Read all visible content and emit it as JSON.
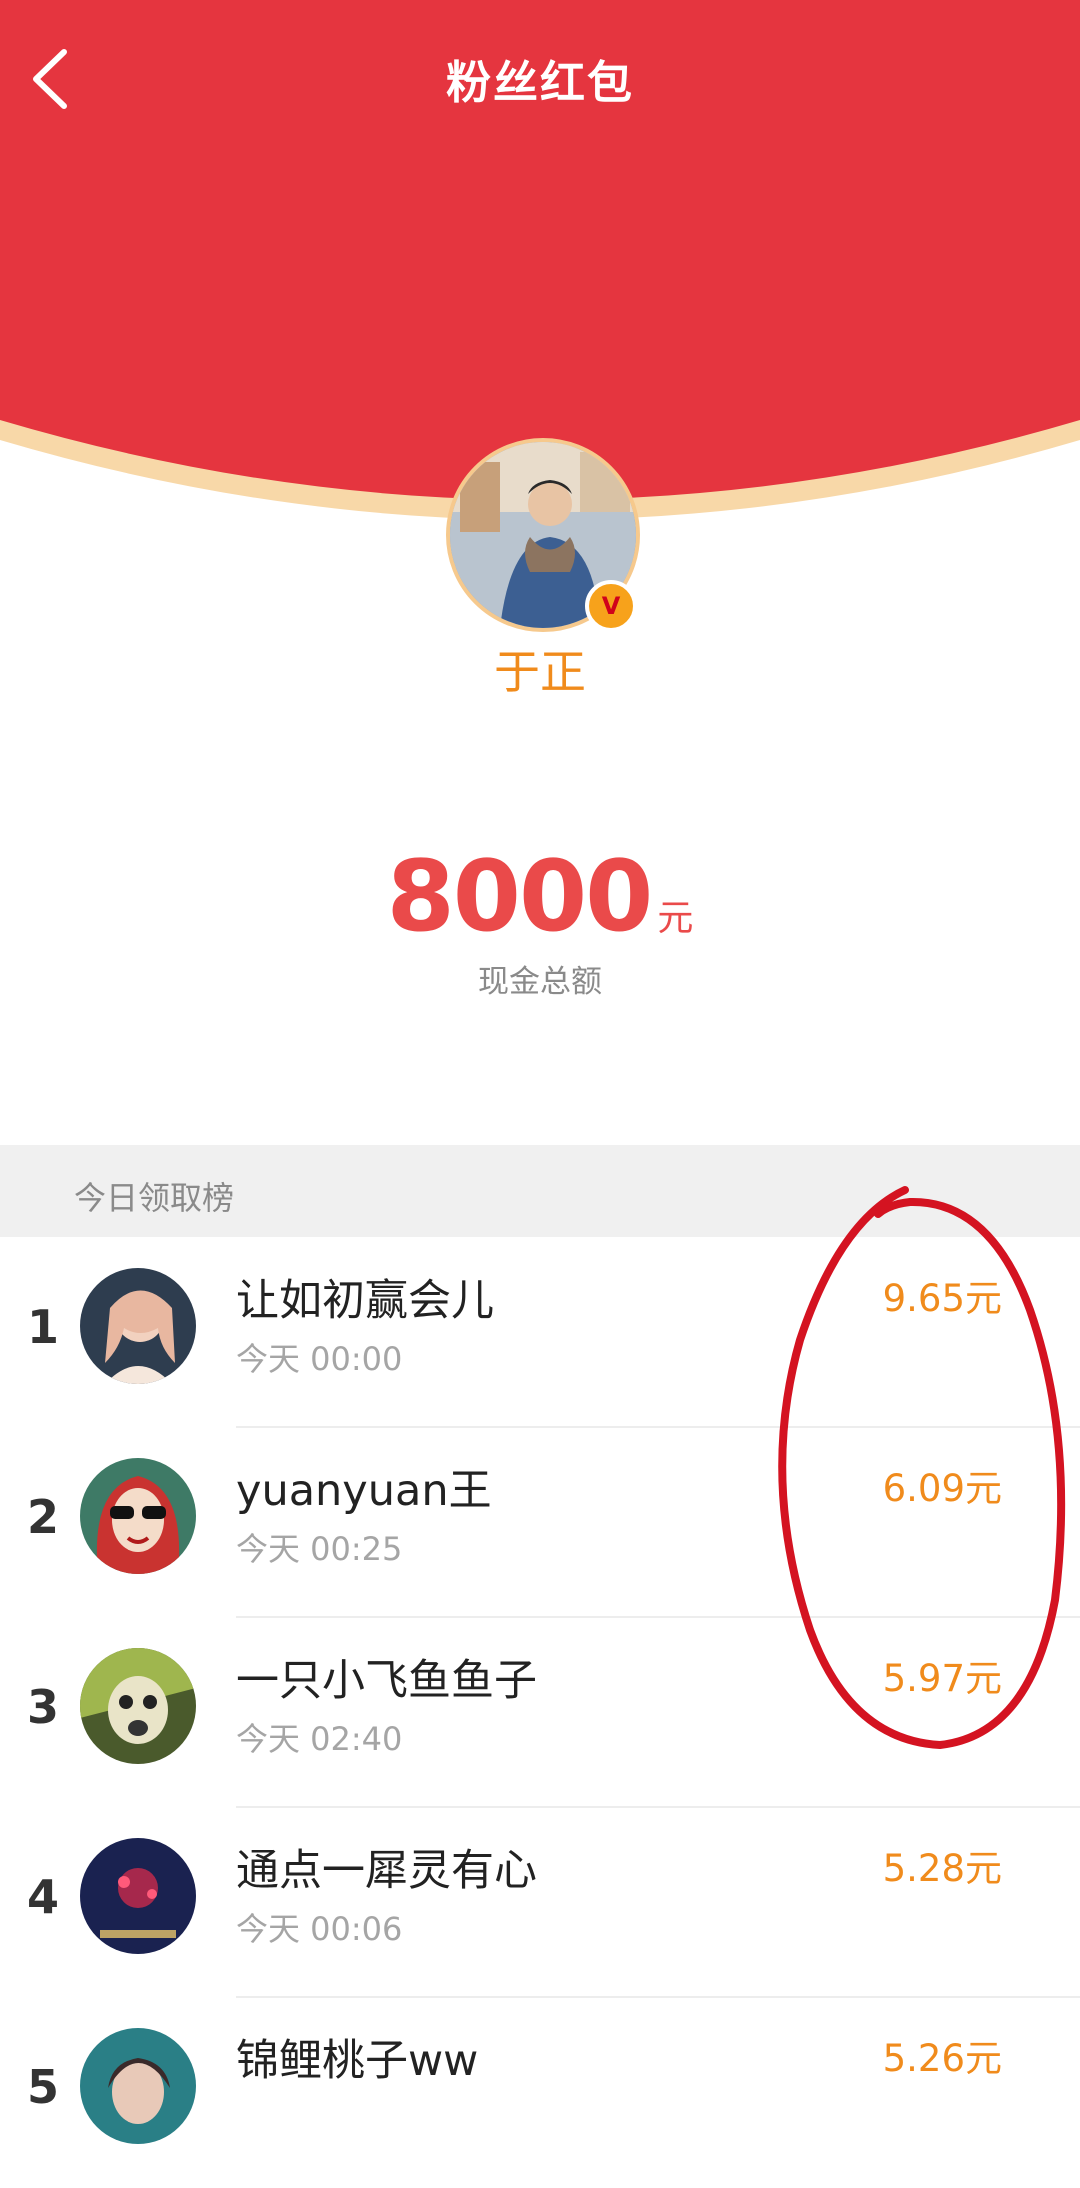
{
  "nav": {
    "title": "粉丝红包",
    "back_icon": "chevron-left-icon"
  },
  "host": {
    "name": "于正",
    "badge": "V"
  },
  "total": {
    "amount": "8000",
    "unit": "元",
    "label": "现金总额"
  },
  "leaderboard": {
    "title": "今日领取榜",
    "rows": [
      {
        "rank": "1",
        "name": "让如初赢会儿",
        "time": "今天 00:00",
        "amount": "9.65元"
      },
      {
        "rank": "2",
        "name": "yuanyuan王",
        "time": "今天 00:25",
        "amount": "6.09元"
      },
      {
        "rank": "3",
        "name": "一只小飞鱼鱼子",
        "time": "今天 02:40",
        "amount": "5.97元"
      },
      {
        "rank": "4",
        "name": "通点一犀灵有心",
        "time": "今天 00:06",
        "amount": "5.28元"
      },
      {
        "rank": "5",
        "name": "锦鲤桃子ww",
        "time": "",
        "amount": "5.26元"
      }
    ]
  },
  "colors": {
    "primary_red": "#e5353f",
    "gold": "#f08b1c",
    "amount_red": "#ea4a4a"
  }
}
